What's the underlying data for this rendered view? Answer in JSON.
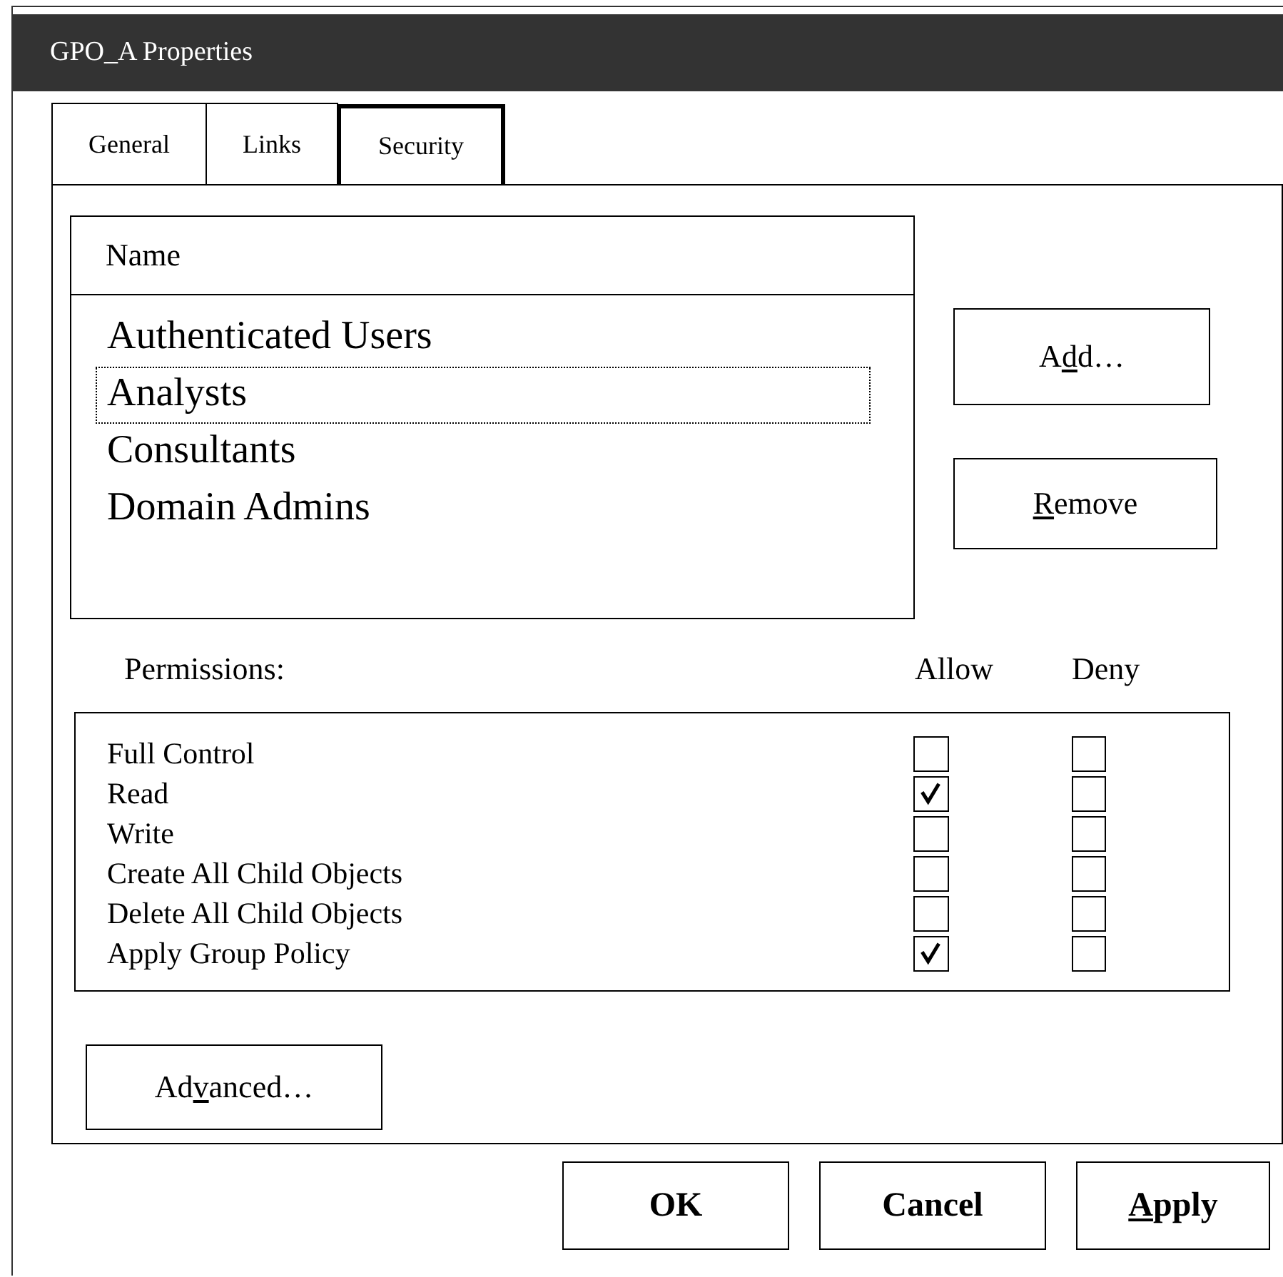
{
  "window": {
    "title": "GPO_A Properties"
  },
  "tabs": [
    {
      "label": "General",
      "selected": false
    },
    {
      "label": "Links",
      "selected": false
    },
    {
      "label": "Security",
      "selected": true
    }
  ],
  "names": {
    "header": "Name",
    "items": [
      {
        "label": "Authenticated Users",
        "selected": false
      },
      {
        "label": "Analysts",
        "selected": true
      },
      {
        "label": "Consultants",
        "selected": false
      },
      {
        "label": "Domain Admins",
        "selected": false
      }
    ]
  },
  "name_buttons": [
    {
      "pre": "A",
      "key": "d",
      "post": "d…"
    },
    {
      "key": "R",
      "post": "emove"
    }
  ],
  "permissions": {
    "label": "Permissions:",
    "allow_label": "Allow",
    "deny_label": "Deny",
    "rows": [
      {
        "name": "Full Control",
        "allow": false,
        "deny": false
      },
      {
        "name": "Read",
        "allow": true,
        "deny": false
      },
      {
        "name": "Write",
        "allow": false,
        "deny": false
      },
      {
        "name": "Create All Child Objects",
        "allow": false,
        "deny": false
      },
      {
        "name": "Delete All Child Objects",
        "allow": false,
        "deny": false
      },
      {
        "name": "Apply Group Policy",
        "allow": true,
        "deny": false
      }
    ]
  },
  "advanced_button": {
    "pre": "Ad",
    "key": "v",
    "post": "anced…"
  },
  "buttons": [
    {
      "post": "OK"
    },
    {
      "post": "Cancel"
    },
    {
      "key": "A",
      "post": "pply"
    }
  ]
}
